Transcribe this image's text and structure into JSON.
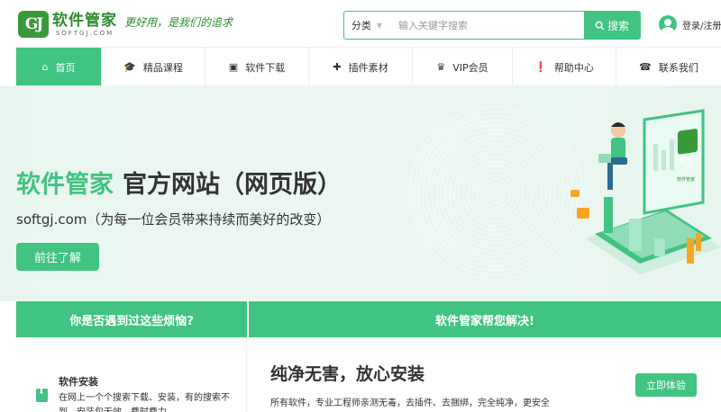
{
  "header": {
    "logo_mark": "GJ",
    "logo_cn": "软件管家",
    "logo_en": "SOFTGJ.COM",
    "slogan": "更好用，是我们的追求",
    "search": {
      "category": "分类",
      "placeholder": "输入关键字搜索",
      "button_label": "搜索"
    },
    "user_label": "登录/注册"
  },
  "nav": {
    "items": [
      {
        "label": "首页",
        "icon": "home-icon"
      },
      {
        "label": "精品课程",
        "icon": "graduation-cap-icon"
      },
      {
        "label": "软件下载",
        "icon": "download-box-icon"
      },
      {
        "label": "插件素材",
        "icon": "puzzle-icon"
      },
      {
        "label": "VIP会员",
        "icon": "crown-icon"
      },
      {
        "label": "帮助中心",
        "icon": "help-icon"
      },
      {
        "label": "联系我们",
        "icon": "phone-icon"
      }
    ]
  },
  "hero": {
    "title_accent": "软件管家",
    "title_rest": "官方网站（网页版）",
    "subtitle": "softgj.com（为每一位会员带来持续而美好的改变）",
    "button_label": "前往了解",
    "monitor_logo": "GJ",
    "monitor_text": "软件管家"
  },
  "section": {
    "left_heading": "你是否遇到过这些烦恼?",
    "right_heading": "软件管家帮您解决!",
    "problem_title": "软件安装",
    "problem_desc": "在网上一个个搜索下载、安装，有的搜索不到，安装包无效，费时费力",
    "solution_title": "纯净无害，放心安装",
    "solution_desc": "所有软件，专业工程师亲测无毒，去插件、去捆绑，完全纯净，更安全",
    "solution_button": "立即体验"
  },
  "colors": {
    "accent": "#41c382",
    "logo_green": "#2e8b2e",
    "hero_bg": "#e9f6f0",
    "text": "#333333"
  }
}
